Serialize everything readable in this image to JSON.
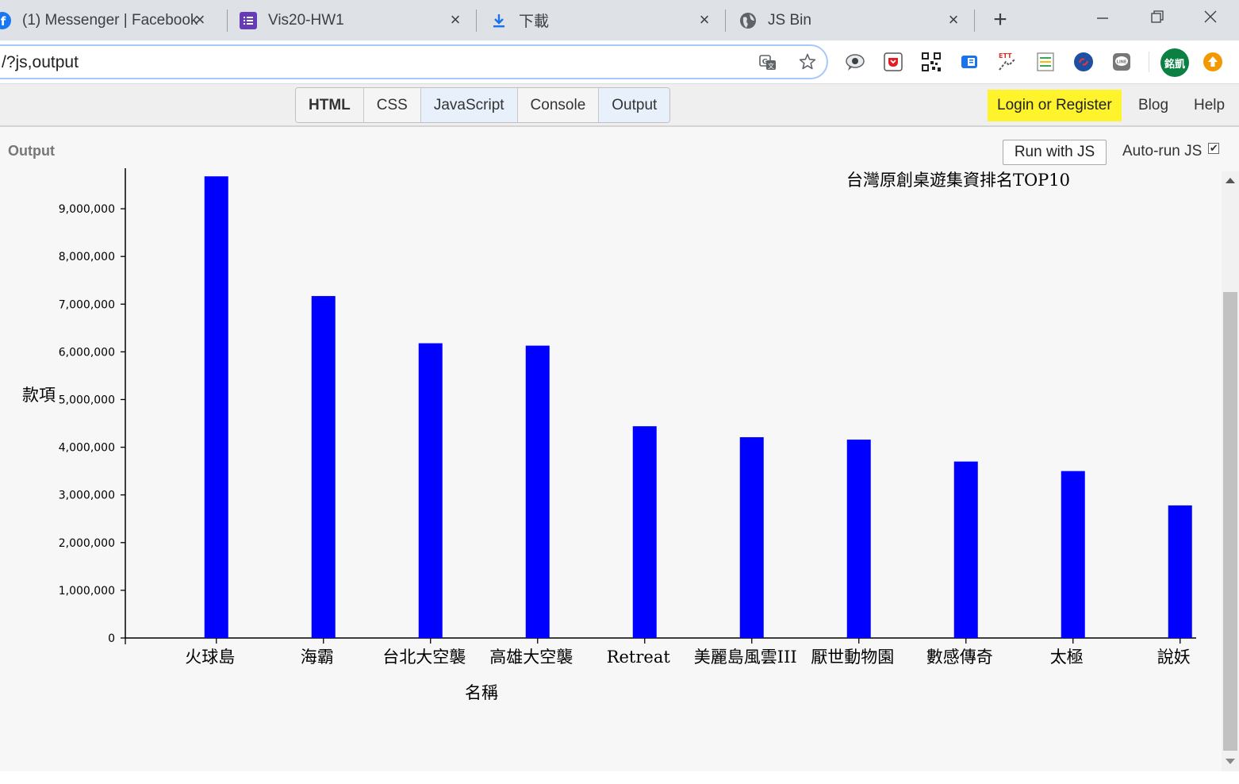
{
  "browser": {
    "tabs": [
      {
        "label": "(1) Messenger | Facebook",
        "icon": "facebook-icon"
      },
      {
        "label": "Vis20-HW1",
        "icon": "forms-icon"
      },
      {
        "label": "下載",
        "icon": "download-icon"
      },
      {
        "label": "JS Bin",
        "icon": "globe-icon"
      }
    ],
    "close_glyph": "×",
    "new_tab_glyph": "+",
    "address": "/?js,output",
    "profile_badge": "銘凱"
  },
  "jsbin": {
    "panels": [
      "HTML",
      "CSS",
      "JavaScript",
      "Console",
      "Output"
    ],
    "login_label": "Login or Register",
    "blog_label": "Blog",
    "help_label": "Help",
    "output_label": "Output",
    "run_label": "Run with JS",
    "autorun_label": "Auto-run JS",
    "autorun_checked": true
  },
  "chart_data": {
    "type": "bar",
    "title": "台灣原創桌遊集資排名TOP10",
    "xlabel": "名稱",
    "ylabel": "款項",
    "color": "#0000ff",
    "ylim": [
      0,
      9850000
    ],
    "yticks": [
      0,
      1000000,
      2000000,
      3000000,
      4000000,
      5000000,
      6000000,
      7000000,
      8000000,
      9000000
    ],
    "ytick_labels": [
      "0",
      "1,000,000",
      "2,000,000",
      "3,000,000",
      "4,000,000",
      "5,000,000",
      "6,000,000",
      "7,000,000",
      "8,000,000",
      "9,000,000"
    ],
    "categories": [
      "火球島",
      "海霸",
      "台北大空襲",
      "高雄大空襲",
      "Retreat",
      "美麗島風雲III",
      "厭世動物園",
      "數感傳奇",
      "太極",
      "說妖"
    ],
    "values": [
      9680000,
      7170000,
      6180000,
      6130000,
      4440000,
      4210000,
      4160000,
      3700000,
      3500000,
      2780000
    ],
    "grid": false,
    "legend": "none"
  }
}
